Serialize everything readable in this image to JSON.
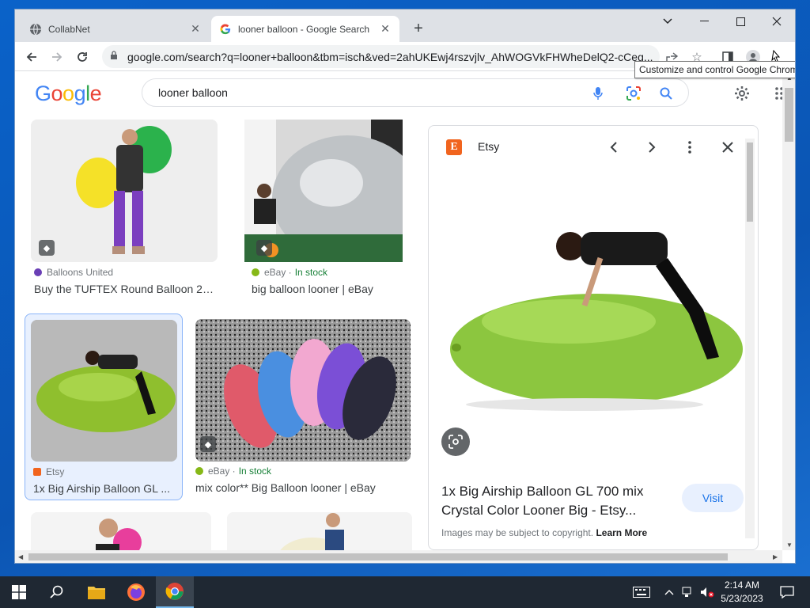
{
  "browser": {
    "tabs": [
      {
        "title": "CollabNet",
        "favicon": "globe-icon"
      },
      {
        "title": "looner balloon - Google Search",
        "favicon": "google-g-icon"
      }
    ],
    "url": "google.com/search?q=looner+balloon&tbm=isch&ved=2ahUKEwj4rszvjlv_AhWOGVkFHWheDelQ2-cCeg...",
    "tooltip": "Customize and control Google Chrome"
  },
  "google": {
    "logo": "Google",
    "query": "looner balloon",
    "colors": {
      "blue": "#4285f4",
      "red": "#ea4335",
      "yellow": "#fbbc05",
      "green": "#34a853"
    }
  },
  "results": [
    {
      "source": "Balloons United",
      "stock": "",
      "caption": "Buy the TUFTEX Round Balloon 24...",
      "source_color": "#6a3fb5"
    },
    {
      "source": "eBay ·",
      "stock": "In stock",
      "caption": "big balloon looner | eBay",
      "source_color": "#86b817"
    },
    {
      "source": "Etsy",
      "stock": "",
      "caption": "1x Big Airship Balloon GL ...",
      "source_color": "#f1641e"
    },
    {
      "source": "eBay ·",
      "stock": "In stock",
      "caption": "mix color** Big Balloon looner | eBay",
      "source_color": "#86b817"
    }
  ],
  "preview": {
    "site": "Etsy",
    "title": "1x Big Airship Balloon GL 700 mix Crystal Color Looner Big - Etsy...",
    "visit": "Visit",
    "copyright": "Images may be subject to copyright.",
    "learn_more": "Learn More"
  },
  "taskbar": {
    "time": "2:14 AM",
    "date": "5/23/2023"
  }
}
